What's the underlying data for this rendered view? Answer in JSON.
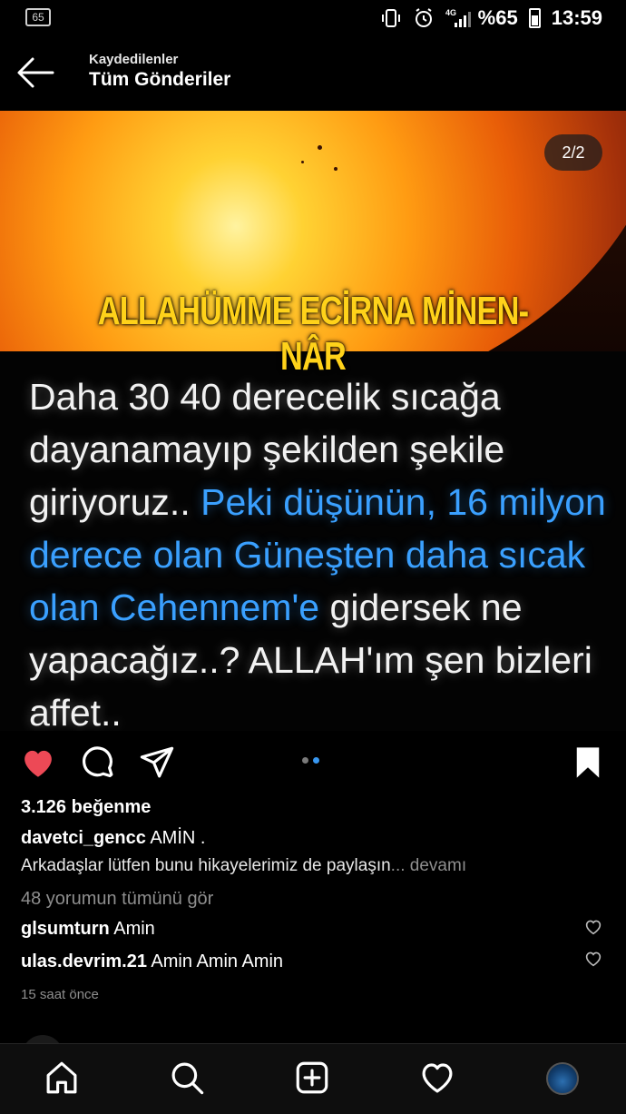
{
  "status_bar": {
    "notification_badge": "65",
    "network": "4G",
    "battery_text": "%65",
    "time": "13:59"
  },
  "header": {
    "subtitle": "Kaydedilenler",
    "title": "Tüm Gönderiler",
    "back_icon": "arrow-left-icon"
  },
  "post": {
    "page_counter": "2/2",
    "image_banner": "ALLAHÜMME ECİRNA MİNEN-NÂR",
    "image_text_white_1": "Daha 30 40 derecelik sıcağa dayanamayıp şekilden şekile giriyoruz..",
    "image_text_blue": "Peki düşünün, 16 milyon derece olan Güneşten daha sıcak olan Cehennem'e",
    "image_text_white_2": "gidersek ne yapacağız..? ALLAH'ım şen bizleri affet..",
    "likes": "3.126 beğenme",
    "author": "davetci_gencc",
    "caption_text": "AMİN .",
    "caption_line2": "Arkadaşlar lütfen bunu hikayelerimiz de paylaşın",
    "more_label": "... devamı",
    "view_all_comments": "48 yorumun tümünü gör",
    "comments": [
      {
        "user": "glsumturn",
        "text": "Amin"
      },
      {
        "user": "ulas.devrim.21",
        "text": "Amin Amin Amin"
      }
    ],
    "timestamp": "15 saat önce",
    "carousel": {
      "count": 2,
      "active_index": 1
    },
    "liked": true,
    "saved": true
  },
  "icons": {
    "like": "heart-filled-icon",
    "comment": "comment-icon",
    "share": "send-icon",
    "save": "bookmark-filled-icon"
  },
  "bottom_nav": [
    "home-icon",
    "search-icon",
    "add-post-icon",
    "activity-heart-icon",
    "profile-avatar"
  ],
  "colors": {
    "like_red": "#ed4956",
    "link_blue": "#3897f0",
    "banner_yellow": "#ffd21a",
    "quote_blue": "#3aa0ff",
    "muted_gray": "#8e8e8e"
  }
}
